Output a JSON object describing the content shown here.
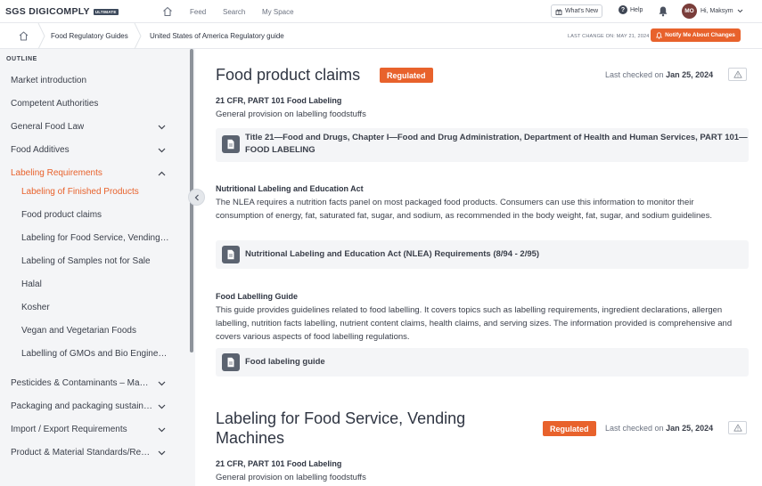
{
  "topbar": {
    "logo_text": "SGS DIGICOMPLY",
    "logo_badge": "ULTIMATE",
    "nav": [
      "Feed",
      "Search",
      "My Space"
    ],
    "whats_new": "What's New",
    "help": "Help",
    "user_initials": "MO",
    "user_greeting": "Hi, Maksym"
  },
  "breadcrumb": {
    "items": [
      "Food Regulatory Guides",
      "United States of America Regulatory guide"
    ],
    "last_change": "LAST CHANGE ON: MAY 21, 2024",
    "notify_button": "Notify Me About Changes"
  },
  "sidebar": {
    "outline_label": "OUTLINE",
    "items": [
      {
        "label": "Market introduction"
      },
      {
        "label": "Competent Authorities"
      },
      {
        "label": "General Food Law"
      },
      {
        "label": "Food Additives"
      },
      {
        "label": "Labeling Requirements"
      },
      {
        "label": "Labeling of Finished Products"
      },
      {
        "label": "Food product claims"
      },
      {
        "label": "Labeling for Food Service, Vending…"
      },
      {
        "label": "Labeling of Samples not for Sale"
      },
      {
        "label": "Halal"
      },
      {
        "label": "Kosher"
      },
      {
        "label": "Vegan and Vegetarian Foods"
      },
      {
        "label": "Labelling of GMOs and Bio Engine…"
      },
      {
        "label": "Pesticides & Contaminants – Ma…"
      },
      {
        "label": "Packaging and packaging sustain…"
      },
      {
        "label": "Import / Export Requirements"
      },
      {
        "label": "Product & Material Standards/Re…"
      }
    ]
  },
  "main": {
    "section1": {
      "title": "Food product claims",
      "badge": "Regulated",
      "last_checked_label": "Last checked on",
      "last_checked_date": "Jan 25, 2024",
      "blocks": [
        {
          "title": "21 CFR, PART 101 Food Labeling",
          "text": "General provision on labelling foodstuffs",
          "link_line1": "Title 21—Food and Drugs, Chapter I—Food and Drug Administration, Department of Health and Human Services, PART 101—",
          "link_line2": "FOOD LABELING"
        },
        {
          "title": "Nutritional Labeling and Education Act",
          "text": "The NLEA requires a nutrition facts panel on most packaged food products. Consumers can use this information to monitor their consumption of energy, fat, saturated fat, sugar, and sodium, as recommended in the body weight, fat, sugar, and sodium guidelines.",
          "link": "Nutritional Labeling and Education Act (NLEA) Requirements (8/94 - 2/95)"
        },
        {
          "title": "Food Labelling Guide",
          "text": "This guide provides guidelines related to food labelling. It covers topics such as labelling requirements, ingredient declarations, allergen labelling, nutrition facts labelling, nutrient content claims, health claims, and serving sizes. The information provided is comprehensive and covers various aspects of food labelling regulations.",
          "link": "Food labeling guide"
        }
      ]
    },
    "section2": {
      "title_line1": "Labeling for Food Service, Vending",
      "title_line2": "Machines",
      "badge": "Regulated",
      "last_checked_label": "Last checked on",
      "last_checked_date": "Jan 25, 2024",
      "block_title": "21 CFR, PART 101 Food Labeling",
      "block_text": "General provision on labelling foodstuffs"
    }
  },
  "colors": {
    "accent": "#e8622c",
    "sidebar_bg": "#f4f5f7",
    "text": "#3a3f4a"
  }
}
